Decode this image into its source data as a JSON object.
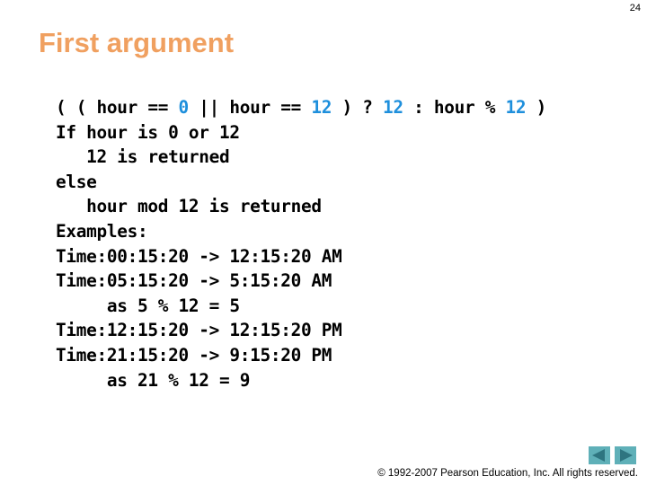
{
  "slide": {
    "number": "24",
    "title": "First argument"
  },
  "code": {
    "line1": [
      {
        "text": "( ( hour == ",
        "type": "plain"
      },
      {
        "text": "0",
        "type": "num"
      },
      {
        "text": " || hour == ",
        "type": "plain"
      },
      {
        "text": "12",
        "type": "num"
      },
      {
        "text": " ) ? ",
        "type": "plain"
      },
      {
        "text": "12",
        "type": "num"
      },
      {
        "text": " : hour % ",
        "type": "plain"
      },
      {
        "text": "12",
        "type": "num"
      },
      {
        "text": " )",
        "type": "plain"
      }
    ],
    "lines": [
      "If hour is 0 or 12",
      "   12 is returned",
      "else",
      "   hour mod 12 is returned",
      "Examples:",
      "Time:00:15:20 -> 12:15:20 AM",
      "Time:05:15:20 -> 5:15:20 AM",
      "     as 5 % 12 = 5",
      "Time:12:15:20 -> 12:15:20 PM",
      "Time:21:15:20 -> 9:15:20 PM",
      "     as 21 % 12 = 9"
    ]
  },
  "navigation": {
    "prev_icon": "triangle-left-icon",
    "next_icon": "triangle-right-icon"
  },
  "footer": {
    "copyright": "© 1992-2007 Pearson Education, Inc.  All rights reserved."
  },
  "colors": {
    "title": "#f0a060",
    "numeric_literal": "#1e8fdc",
    "nav_button": "#5fb0b8",
    "nav_arrow": "#2e7580"
  }
}
